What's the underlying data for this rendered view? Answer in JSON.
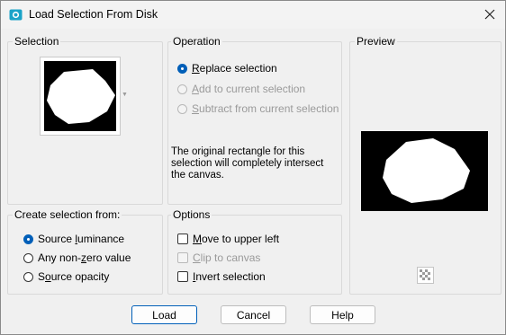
{
  "window": {
    "title": "Load Selection From Disk"
  },
  "selection": {
    "label": "Selection"
  },
  "operation": {
    "label": "Operation",
    "options": [
      {
        "pre": "",
        "key": "R",
        "post": "eplace selection",
        "selected": true,
        "enabled": true
      },
      {
        "pre": "",
        "key": "A",
        "post": "dd to current selection",
        "selected": false,
        "enabled": false
      },
      {
        "pre": "",
        "key": "S",
        "post": "ubtract from current selection",
        "selected": false,
        "enabled": false
      }
    ],
    "message": "The original rectangle for this selection will completely intersect the canvas."
  },
  "preview": {
    "label": "Preview"
  },
  "create_from": {
    "label": "Create selection from:",
    "options": [
      {
        "pre": "Source ",
        "key": "l",
        "post": "uminance",
        "selected": true
      },
      {
        "pre": "Any non-",
        "key": "z",
        "post": "ero value",
        "selected": false
      },
      {
        "pre": "S",
        "key": "o",
        "post": "urce opacity",
        "selected": false
      }
    ]
  },
  "options": {
    "label": "Options",
    "checks": [
      {
        "pre": "",
        "key": "M",
        "post": "ove to upper left",
        "checked": false,
        "enabled": true
      },
      {
        "pre": "",
        "key": "C",
        "post": "lip to canvas",
        "checked": false,
        "enabled": false
      },
      {
        "pre": "",
        "key": "I",
        "post": "nvert selection",
        "checked": false,
        "enabled": true
      }
    ]
  },
  "buttons": {
    "load": "Load",
    "cancel": "Cancel",
    "help": "Help"
  },
  "colors": {
    "accent": "#005fb8",
    "mask_bg": "#000000",
    "mask_fg": "#ffffff"
  }
}
